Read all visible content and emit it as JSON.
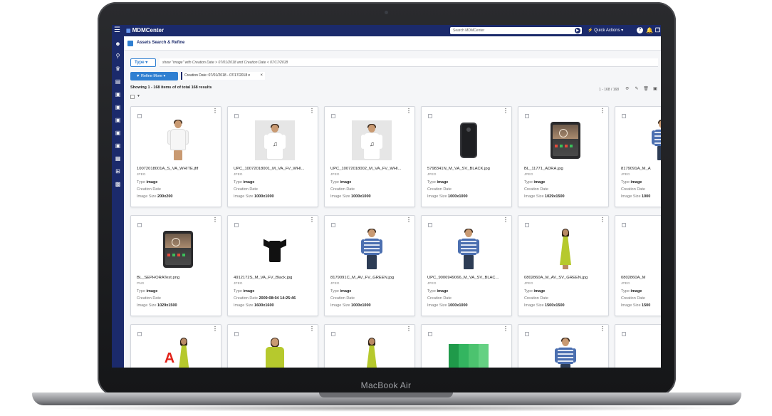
{
  "device": {
    "brand_label": "MacBook Air"
  },
  "app": {
    "logo": "MDMCenter",
    "search_placeholder": "Search MDMCenter",
    "quick_actions": "Quick Actions",
    "help_icon": "?"
  },
  "panel": {
    "title": "Assets Search & Refine"
  },
  "filters": {
    "type_label": "Type",
    "query": "show \"image\" with Creation Date > 07/01/2018  and Creation Date <  07/17/2018",
    "refine_label": "Refine More",
    "chip": "Creation Date :07/01/2018 - 07/17/2018"
  },
  "results": {
    "showing": "Showing 1 - 168 items of of total 168 results",
    "range": "1 - 168 / 168"
  },
  "field_labels": {
    "type": "Type",
    "creation_date": "Creation Date",
    "image_size": "Image Size"
  },
  "cards": [
    {
      "name": "10072018001A_S_VA_WHITE.jfif",
      "format": "JPEG",
      "type": "image",
      "creation_date": "",
      "image_size": "200x200",
      "thumb": "blouse-white"
    },
    {
      "name": "UPC_10072018001_M_VA_FV_WHI...",
      "format": "JPEG",
      "type": "image",
      "creation_date": "",
      "image_size": "1000x1000",
      "thumb": "man-white-tee"
    },
    {
      "name": "UPC_10072018002_M_VA_FV_WHI...",
      "format": "JPEG",
      "type": "image",
      "creation_date": "",
      "image_size": "1000x1000",
      "thumb": "man-white-tee"
    },
    {
      "name": "5798341N_M_VA_SV_BLACK.jpg",
      "format": "JPEG",
      "type": "image",
      "creation_date": "",
      "image_size": "1000x1000",
      "thumb": "phone-case"
    },
    {
      "name": "BL_11771_ADRA.jpg",
      "format": "JPEG",
      "type": "image",
      "creation_date": "",
      "image_size": "1029x1500",
      "thumb": "tablet"
    },
    {
      "name": "8179091A_M_A",
      "format": "JPEG",
      "type": "image",
      "creation_date": "",
      "image_size": "1000",
      "thumb": "man-shirt"
    },
    {
      "name": "BL_SEPHORATest.png",
      "format": "PNG",
      "type": "image",
      "creation_date": "",
      "image_size": "1029x1500",
      "thumb": "tablet"
    },
    {
      "name": "4912172S_M_VA_FV_Black.jpg",
      "format": "JPEG",
      "type": "image",
      "creation_date": "2009:08:04 14:25:46",
      "image_size": "1600x1600",
      "thumb": "black-tee"
    },
    {
      "name": "8179091C_M_AV_FV_GREEN.jpg",
      "format": "JPEG",
      "type": "image",
      "creation_date": "",
      "image_size": "1000x1000",
      "thumb": "man-shirt"
    },
    {
      "name": "UPC_9006949066_M_VA_SV_BLAC...",
      "format": "JPEG",
      "type": "image",
      "creation_date": "",
      "image_size": "1000x1000",
      "thumb": "man-shirt"
    },
    {
      "name": "0802860A_M_AV_SV_GREEN.jpg",
      "format": "JPEG",
      "type": "image",
      "creation_date": "",
      "image_size": "1500x1500",
      "thumb": "green-dress"
    },
    {
      "name": "0802860A_M",
      "format": "JPEG",
      "type": "image",
      "creation_date": "",
      "image_size": "1500",
      "thumb": "none"
    },
    {
      "name": "",
      "format": "",
      "type": "",
      "creation_date": "",
      "image_size": "",
      "thumb": "green-dress-logo",
      "logo_letter": "A"
    },
    {
      "name": "",
      "format": "",
      "type": "",
      "creation_date": "",
      "image_size": "",
      "thumb": "woman-green"
    },
    {
      "name": "",
      "format": "",
      "type": "",
      "creation_date": "",
      "image_size": "",
      "thumb": "green-dress"
    },
    {
      "name": "",
      "format": "",
      "type": "",
      "creation_date": "",
      "image_size": "",
      "thumb": "green-swatch"
    },
    {
      "name": "",
      "format": "",
      "type": "",
      "creation_date": "",
      "image_size": "",
      "thumb": "man-shirt"
    },
    {
      "name": "",
      "format": "",
      "type": "",
      "creation_date": "",
      "image_size": "",
      "thumb": "none"
    }
  ],
  "colors": {
    "nav": "#1b2a6b",
    "accent": "#2f7fd1",
    "shirt_blue": "#4b6fb0",
    "dress_green": "#b6c92d"
  }
}
